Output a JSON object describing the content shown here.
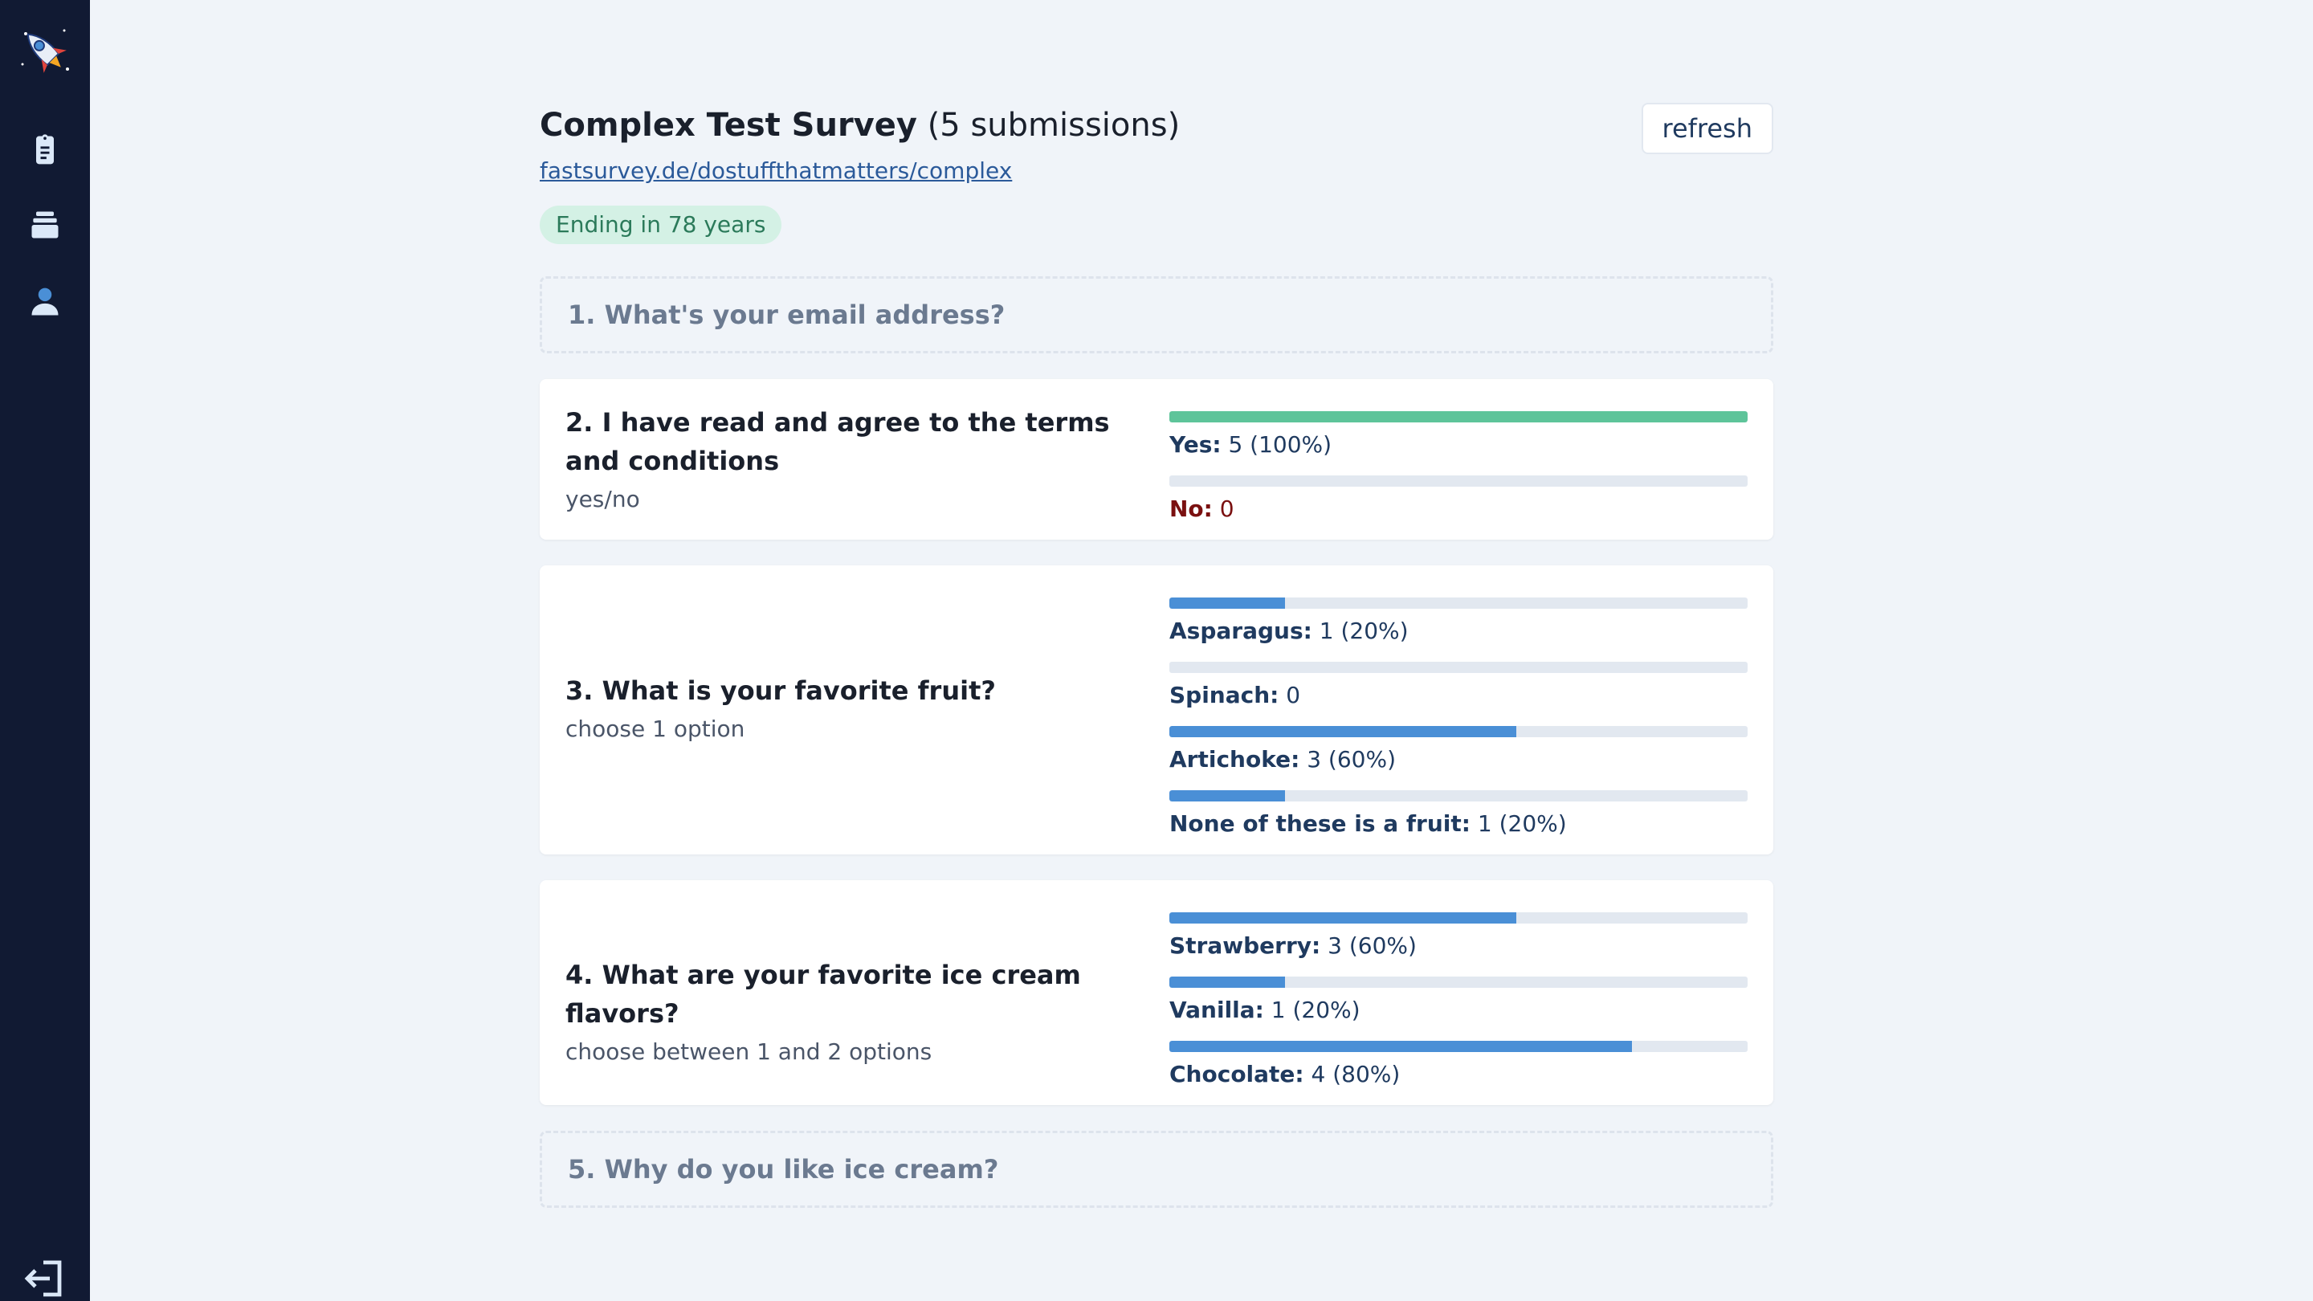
{
  "survey": {
    "title": "Complex Test Survey",
    "submissions_text": "(5 submissions)",
    "link": "fastsurvey.de/dostuffthatmatters/complex",
    "ending": "Ending in 78 years",
    "refresh_label": "refresh"
  },
  "nav": {
    "icons": [
      "logo-icon",
      "clipboard-icon",
      "stack-icon",
      "user-icon",
      "logout-icon"
    ]
  },
  "questions": [
    {
      "title": "1. What's your email address?"
    },
    {
      "title": "2. I have read and agree to the terms and conditions",
      "subtitle": "yes/no",
      "answers": [
        {
          "label": "Yes:",
          "value": "5 (100%)",
          "fraction": 1.0
        },
        {
          "label": "No:",
          "value": "0",
          "fraction": 0.0
        }
      ]
    },
    {
      "title": "3. What is your favorite fruit?",
      "subtitle": "choose 1 option",
      "answers": [
        {
          "label": "Asparagus:",
          "value": "1 (20%)",
          "fraction": 0.2
        },
        {
          "label": "Spinach:",
          "value": "0",
          "fraction": 0.0
        },
        {
          "label": "Artichoke:",
          "value": "3 (60%)",
          "fraction": 0.6
        },
        {
          "label": "None of these is a fruit:",
          "value": "1 (20%)",
          "fraction": 0.2
        }
      ]
    },
    {
      "title": "4. What are your favorite ice cream flavors?",
      "subtitle": "choose between 1 and 2 options",
      "answers": [
        {
          "label": "Strawberry:",
          "value": "3 (60%)",
          "fraction": 0.6
        },
        {
          "label": "Vanilla:",
          "value": "1 (20%)",
          "fraction": 0.2
        },
        {
          "label": "Chocolate:",
          "value": "4 (80%)",
          "fraction": 0.8
        }
      ]
    },
    {
      "title": "5. Why do you like ice cream?"
    }
  ],
  "colors": {
    "sidebar": "#111a33",
    "background": "#f0f4f9",
    "bar_blue": "#4a8fd6",
    "bar_green": "#5ec49a",
    "no_red": "#7a1010",
    "badge_bg": "#d4f1e5"
  }
}
